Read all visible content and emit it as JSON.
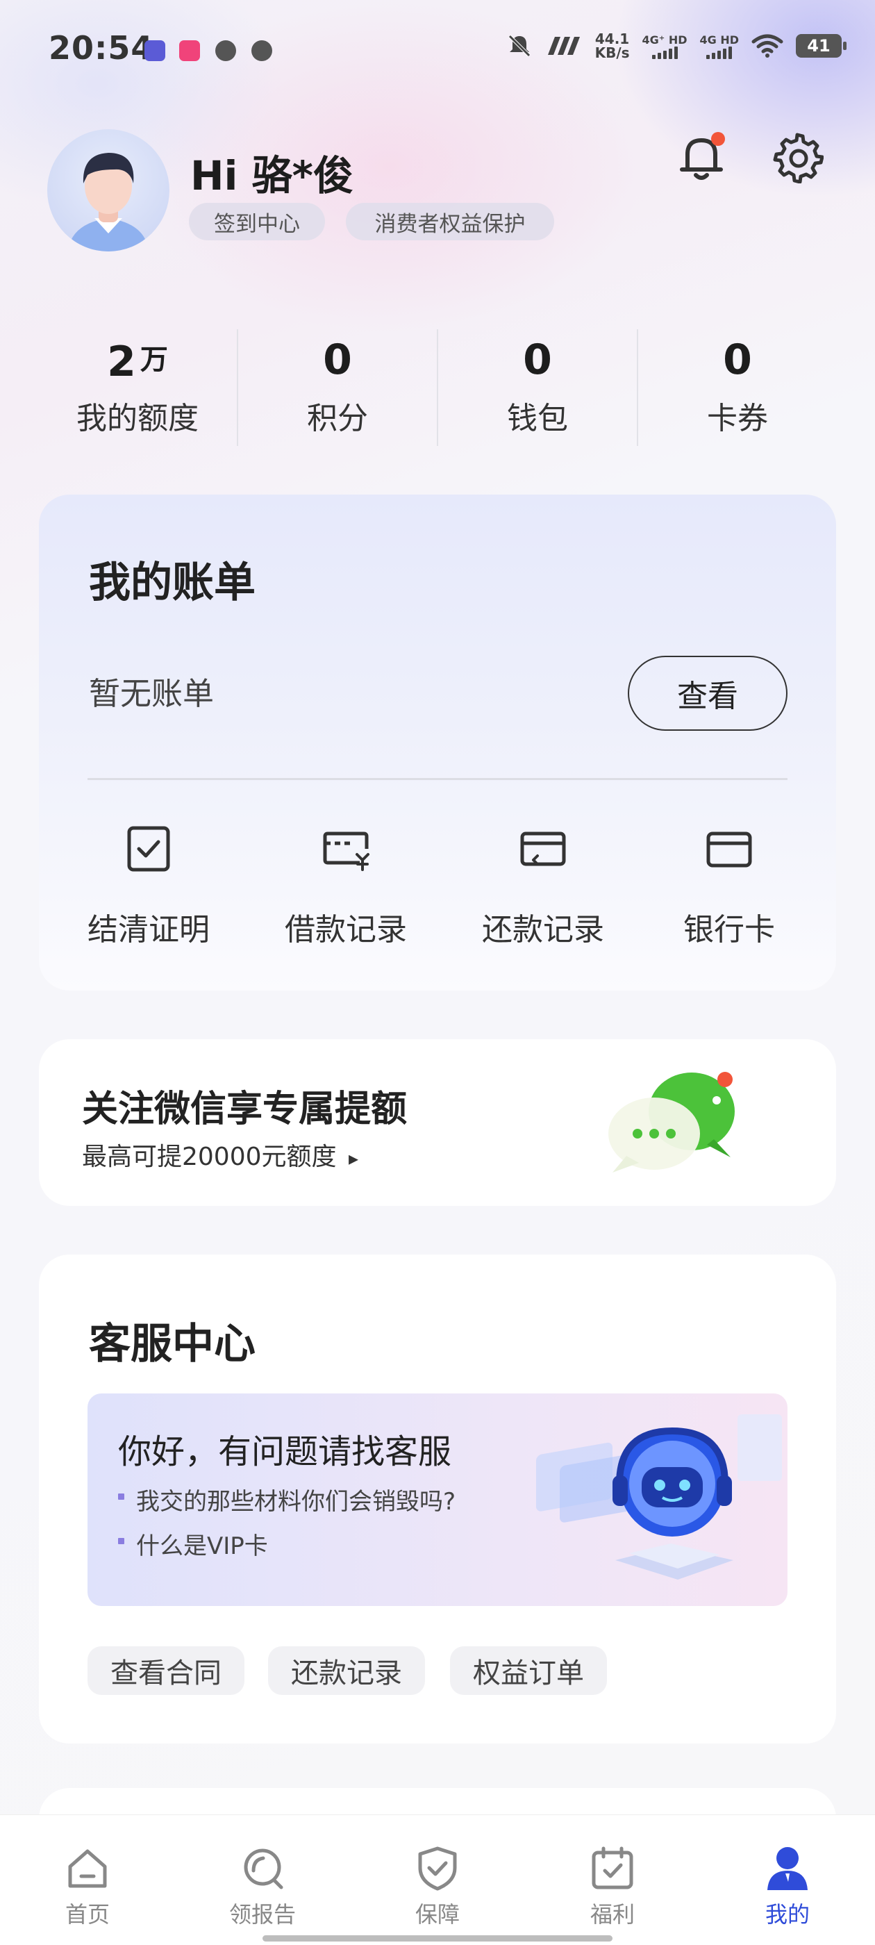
{
  "status_bar": {
    "time": "20:54",
    "net_speed_value": "44.1",
    "net_speed_unit": "KB/s",
    "signal1_label": "4G⁺ HD",
    "signal2_label": "4G HD",
    "battery": "41"
  },
  "profile": {
    "greeting": "Hi 骆*俊",
    "checkin_label": "签到中心",
    "consumer_rights_label": "消费者权益保护",
    "has_notification_dot": true
  },
  "stats": [
    {
      "value": "2",
      "unit": "万",
      "label": "我的额度"
    },
    {
      "value": "0",
      "unit": "",
      "label": "积分"
    },
    {
      "value": "0",
      "unit": "",
      "label": "钱包"
    },
    {
      "value": "0",
      "unit": "",
      "label": "卡券"
    }
  ],
  "bill": {
    "title": "我的账单",
    "empty_text": "暂无账单",
    "view_button": "查看",
    "actions": [
      {
        "label": "结清证明",
        "icon": "doc-check-icon"
      },
      {
        "label": "借款记录",
        "icon": "card-yen-icon"
      },
      {
        "label": "还款记录",
        "icon": "card-return-icon"
      },
      {
        "label": "银行卡",
        "icon": "bank-card-icon"
      }
    ]
  },
  "wechat_promo": {
    "title": "关注微信享专属提额",
    "subtitle": "最高可提20000元额度",
    "arrow": "▸"
  },
  "service": {
    "title": "客服中心",
    "banner_greeting": "你好，有问题请找客服",
    "questions": [
      "我交的那些材料你们会销毁吗?",
      "什么是VIP卡"
    ],
    "tags": [
      "查看合同",
      "还款记录",
      "权益订单"
    ]
  },
  "tabbar": {
    "items": [
      {
        "label": "首页",
        "icon": "home-icon",
        "active": false
      },
      {
        "label": "领报告",
        "icon": "report-search-icon",
        "active": false
      },
      {
        "label": "保障",
        "icon": "shield-check-icon",
        "active": false
      },
      {
        "label": "福利",
        "icon": "calendar-check-icon",
        "active": false
      },
      {
        "label": "我的",
        "icon": "person-icon",
        "active": true
      }
    ]
  },
  "colors": {
    "accent": "#2f4cd9",
    "notification_dot": "#f2553a",
    "wechat_green": "#4cc23a"
  }
}
